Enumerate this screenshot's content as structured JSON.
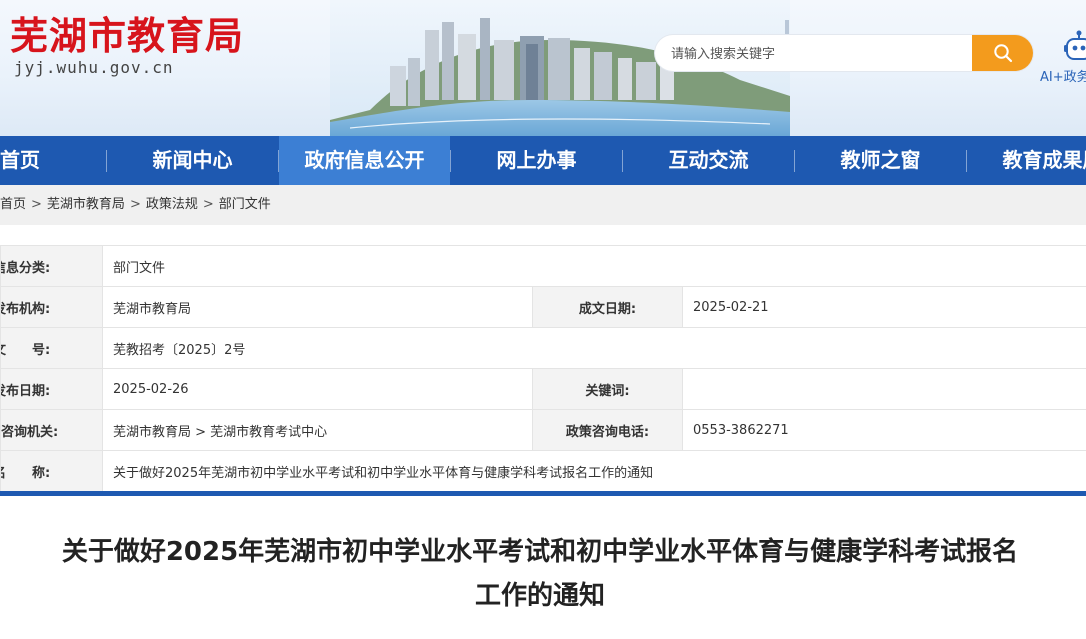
{
  "header": {
    "site_name": "芜湖市教育局",
    "site_domain": "jyj.wuhu.gov.cn",
    "search": {
      "placeholder": "请输入搜索关键字",
      "button_icon": "search-icon"
    },
    "ai_label": "AI+政务"
  },
  "nav": {
    "items": [
      {
        "label": "首页"
      },
      {
        "label": "新闻中心"
      },
      {
        "label": "政府信息公开",
        "active": true
      },
      {
        "label": "网上办事"
      },
      {
        "label": "互动交流"
      },
      {
        "label": "教师之窗"
      },
      {
        "label": "教育成果展"
      }
    ]
  },
  "breadcrumb": [
    "首页",
    "芜湖市教育局",
    "政策法规",
    "部门文件"
  ],
  "info": {
    "category_label": "信息分类:",
    "category_value": "部门文件",
    "publisher_label": "发布机构:",
    "publisher_value": "芜湖市教育局",
    "written_date_label": "成文日期:",
    "written_date_value": "2025-02-21",
    "doc_no_label": "文　　号:",
    "doc_no_value": "芜教招考〔2025〕2号",
    "publish_date_label": "发布日期:",
    "publish_date_value": "2025-02-26",
    "keywords_label": "关键词:",
    "keywords_value": "",
    "consult_org_label": "政策咨询机关:",
    "consult_org_value": "芜湖市教育局 > 芜湖市教育考试中心",
    "consult_phone_label": "政策咨询电话:",
    "consult_phone_value": "0553-3862271",
    "name_label": "名　　称:",
    "name_value": "关于做好2025年芜湖市初中学业水平考试和初中学业水平体育与健康学科考试报名工作的通知"
  },
  "article": {
    "title_line1": "关于做好2025年芜湖市初中学业水平考试和初中学业水平体育与健康学科考试报名",
    "title_line2": "工作的通知"
  },
  "colors": {
    "brand_red": "#d7141c",
    "nav_blue": "#1e59b1",
    "nav_active": "#3c7fd4",
    "search_orange": "#f39b1d"
  }
}
